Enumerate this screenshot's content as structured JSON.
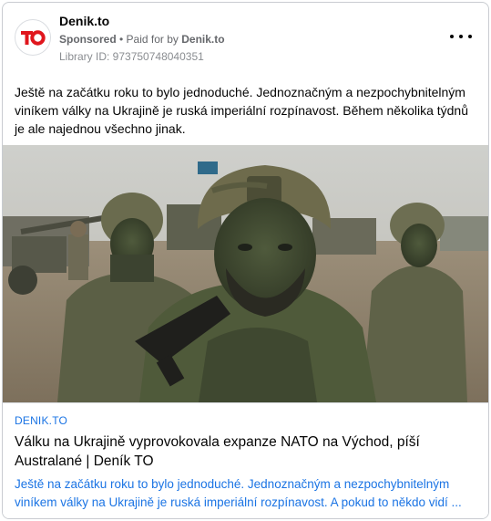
{
  "ad": {
    "page_name": "Denik.to",
    "logo_text": "TO",
    "sponsored_label": "Sponsored",
    "separator": " • ",
    "paid_for_prefix": "Paid for by ",
    "paid_for_by": "Denik.to",
    "library_id": "Library ID: 973750748040351",
    "brand_color": "#e0161d"
  },
  "post": {
    "text": "Ještě na začátku roku to bylo jednoduché. Jednoznačným a nezpochybnitelným viníkem války na Ukrajině je ruská imperiální rozpínavost. Během několika týdnů je ale najednou všechno jinak."
  },
  "link": {
    "domain": "DENIK.TO",
    "title": "Válku na Ukrajině vyprovokovala expanze NATO na Východ, píší Australané | Deník TO",
    "description": "Ještě na začátku roku to bylo jednoduché. Jednoznačným a nezpochybnitelným viníkem války na Ukrajině je ruská imperiální rozpínavost. A pokud to někdo vidí ..."
  },
  "icons": {
    "more": "more-horizontal-icon",
    "logo": "denik-to-logo"
  }
}
